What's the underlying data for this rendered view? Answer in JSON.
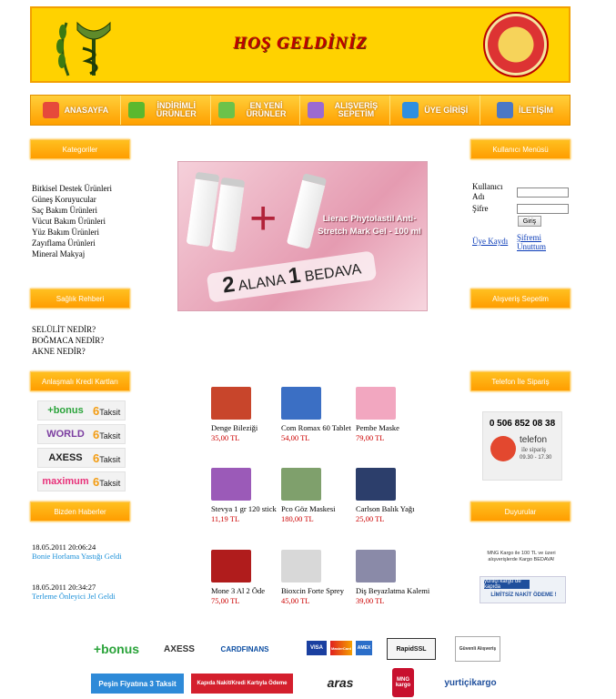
{
  "header": {
    "title": "HOŞ GELDİNİZ",
    "ministry_logo_text": "T.C. SAĞLIK BAKANLIĞI"
  },
  "nav": [
    {
      "label": "ANASAYFA",
      "icon": "home-icon",
      "color": "#e64a3b"
    },
    {
      "label": "İNDİRİMLİ ÜRÜNLER",
      "icon": "down-arrow-icon",
      "color": "#5bb82e"
    },
    {
      "label": "EN YENİ ÜRÜNLER",
      "icon": "star-icon",
      "color": "#6cc24a"
    },
    {
      "label": "ALIŞVERİŞ SEPETİM",
      "icon": "shopping-box-icon",
      "color": "#9b6ad1"
    },
    {
      "label": "ÜYE GİRİŞİ",
      "icon": "users-icon",
      "color": "#2f8fe0"
    },
    {
      "label": "İLETİŞİM",
      "icon": "phone-icon",
      "color": "#4b78c6"
    }
  ],
  "left": {
    "categories": {
      "heading": "Kategoriler",
      "items": [
        "Bitkisel Destek Ürünleri",
        "Güneş Koruyucular",
        "Saç Bakım Ürünleri",
        "Vücut Bakım Ürünleri",
        "Yüz Bakım Ürünleri",
        "Zayıflama Ürünleri",
        "Mineral Makyaj"
      ]
    },
    "health_guide": {
      "heading": "Sağlık Rehberi",
      "items": [
        "SELÜLİT NEDİR?",
        "BOĞMACA NEDİR?",
        "AKNE NEDİR?"
      ]
    },
    "credit_cards": {
      "heading": "Anlaşmalı Kredi Kartları",
      "cards": [
        {
          "name": "+bonus",
          "color": "#2aa33a",
          "installments": "6",
          "unit": "Taksit"
        },
        {
          "name": "WORLD",
          "color": "#7b3da0",
          "installments": "6",
          "unit": "Taksit"
        },
        {
          "name": "AXESS",
          "color": "#222222",
          "installments": "6",
          "unit": "Taksit"
        },
        {
          "name": "maximum",
          "color": "#e8327a",
          "installments": "6",
          "unit": "Taksit"
        }
      ]
    },
    "news": {
      "heading": "Bizden Haberler",
      "items": [
        {
          "date": "18.05.2011 20:06:24",
          "title": "Bonie Horlama Yastığı Geldi"
        },
        {
          "date": "18.05.2011 20:34:27",
          "title": "Terleme Önleyici Jel Geldi"
        }
      ]
    }
  },
  "banner": {
    "title": "Lierac Phytolastil Anti-Stretch Mark Gel - 100 ml",
    "offer_prefix": "2",
    "offer_mid": "ALANA",
    "offer_num": "1",
    "offer_suffix": "BEDAVA"
  },
  "products": [
    {
      "name": "Denge Bileziği",
      "price": "35,00 TL",
      "color": "#c8452b"
    },
    {
      "name": "Com Romax 60 Tablet",
      "price": "54,00 TL",
      "color": "#3b6fc4"
    },
    {
      "name": "Pembe Maske",
      "price": "79,00 TL",
      "color": "#f2a7c0"
    },
    {
      "name": "Stevya 1 gr 120 stick",
      "price": "11,19 TL",
      "color": "#9b5ab8"
    },
    {
      "name": "Pco Göz Maskesi",
      "price": "180,00 TL",
      "color": "#7fa06c"
    },
    {
      "name": "Carlson Balık Yağı",
      "price": "25,00 TL",
      "color": "#2c3e6b"
    },
    {
      "name": "Mone 3 Al 2 Öde",
      "price": "75,00 TL",
      "color": "#b01c1c"
    },
    {
      "name": "Bioxcin Forte Sprey",
      "price": "45,00 TL",
      "color": "#d8d8d8"
    },
    {
      "name": "Diş Beyazlatma Kalemi",
      "price": "39,00 TL",
      "color": "#8a8aa8"
    }
  ],
  "right": {
    "user_menu": {
      "heading": "Kullanıcı Menüsü",
      "username_label": "Kullanıcı Adı",
      "password_label": "Şifre",
      "login_button": "Giriş",
      "register_link": "Üye Kaydı",
      "forgot_link": "Şifremi Unuttum"
    },
    "cart": {
      "heading": "Alışveriş Sepetim"
    },
    "phone_order": {
      "heading": "Telefon İle Sipariş",
      "phone": "0 506 852 08 38",
      "caption": "telefon",
      "subcaption": "ile sipariş",
      "hours": "09.30 - 17.30"
    },
    "announcements": {
      "heading": "Duyurular",
      "cargo_text": "MNG Kargo ile 100 TL ve üzeri alışverişlerde Kargo BEDAVA!",
      "yurtici_text": "yurtiçi kargo de kapıda",
      "cash_text": "LİMİTSİZ NAKİT ÖDEME !"
    }
  },
  "footer": {
    "row1": [
      "+bonus",
      "AXESS",
      "CARDFINANS",
      "VISA",
      "MasterCard",
      "AMEX",
      "RapidSSL",
      "Güvenli Alışveriş"
    ],
    "row2": [
      "Peşin Fiyatına 3 Taksit",
      "Kapıda Nakit/Kredi Kartıyla Ödeme",
      "aras",
      "MNG kargo",
      "yurtiçikargo"
    ]
  }
}
